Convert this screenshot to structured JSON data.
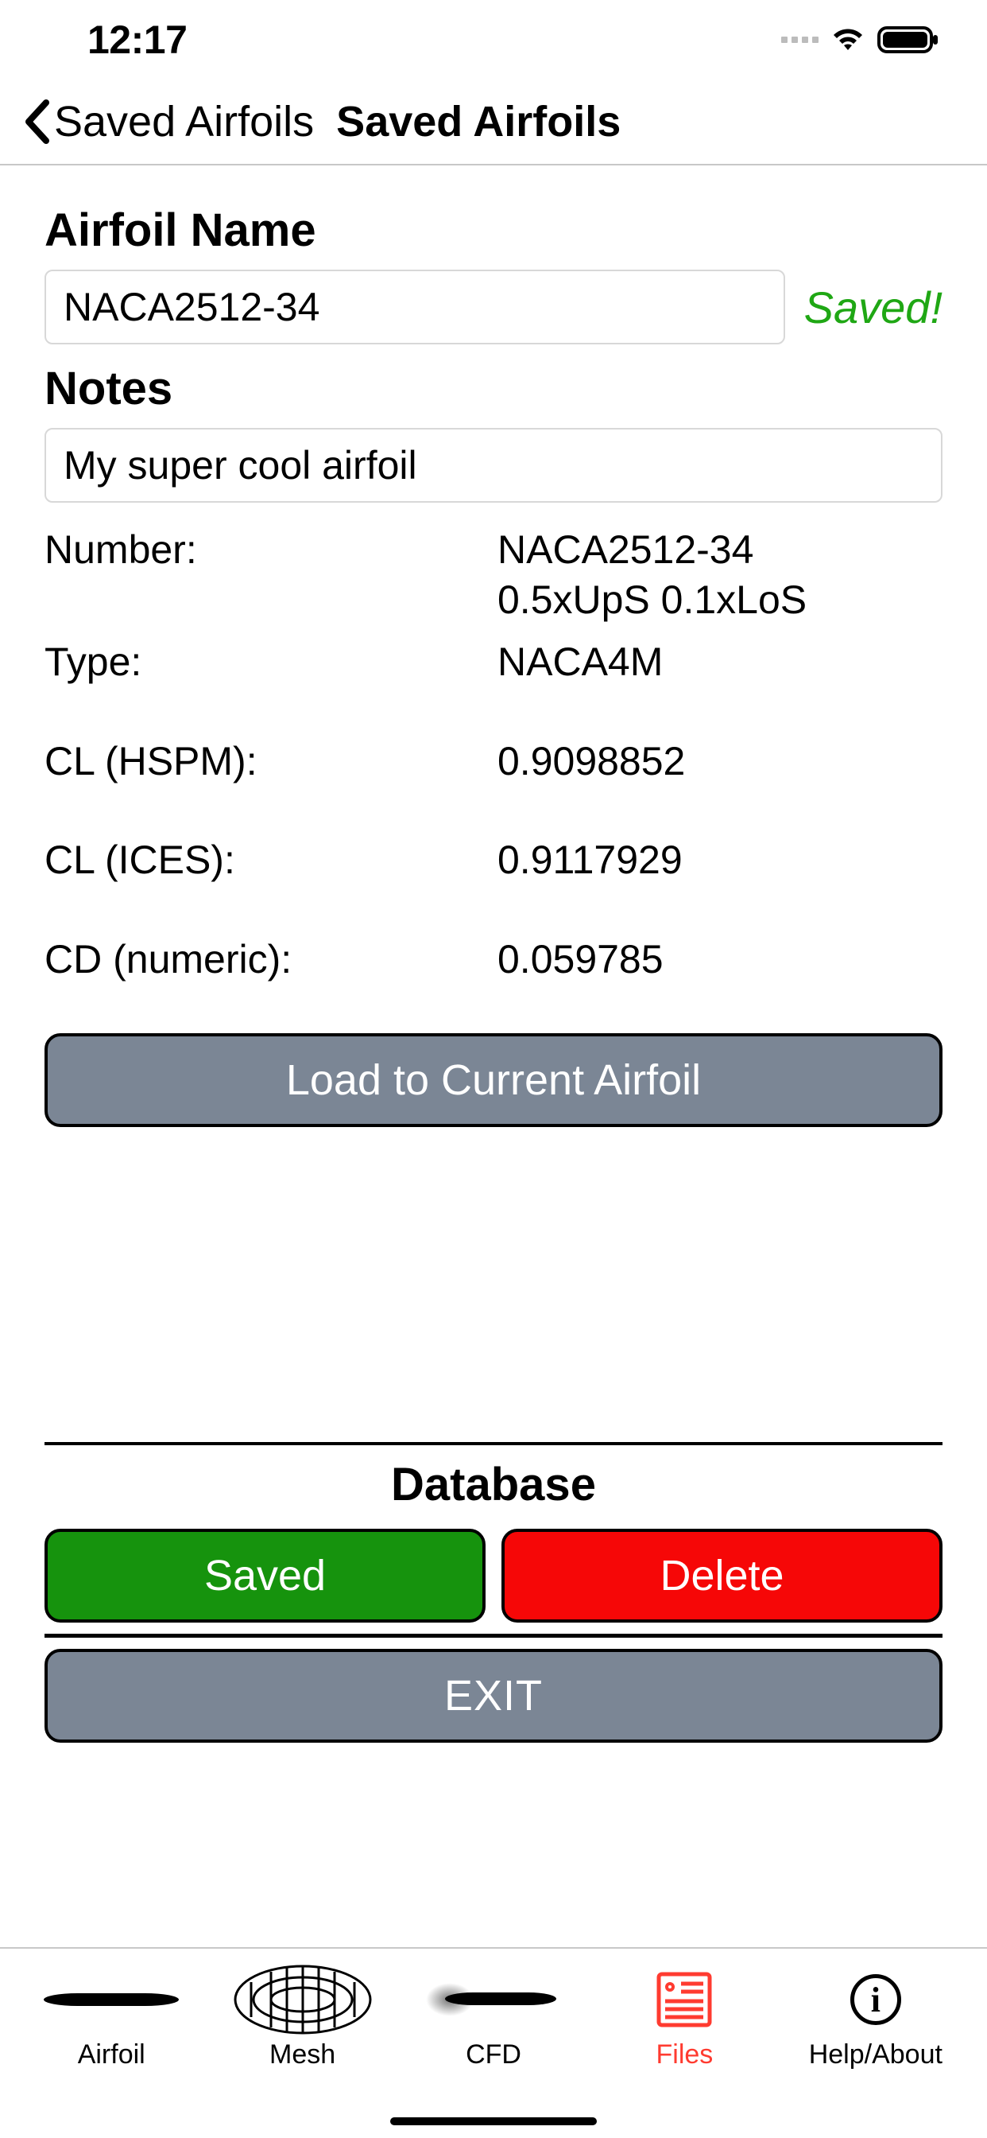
{
  "status": {
    "time": "12:17"
  },
  "nav": {
    "back_label": "Saved Airfoils",
    "title": "Saved Airfoils"
  },
  "form": {
    "name_label": "Airfoil Name",
    "name_value": "NACA2512-34",
    "saved_badge": "Saved!",
    "notes_label": "Notes",
    "notes_value": "My super cool airfoil"
  },
  "details": {
    "number_label": "Number:",
    "number_value_line1": "NACA2512-34",
    "number_value_line2": "0.5xUpS 0.1xLoS",
    "type_label": "Type:",
    "type_value": "NACA4M",
    "cl_hspm_label": "CL (HSPM):",
    "cl_hspm_value": "0.9098852",
    "cl_ices_label": "CL (ICES):",
    "cl_ices_value": "0.9117929",
    "cd_label": "CD (numeric):",
    "cd_value": "0.059785"
  },
  "buttons": {
    "load": "Load to Current Airfoil",
    "database_heading": "Database",
    "saved": "Saved",
    "delete": "Delete",
    "exit": "EXIT"
  },
  "tabs": {
    "airfoil": "Airfoil",
    "mesh": "Mesh",
    "cfd": "CFD",
    "files": "Files",
    "help": "Help/About"
  }
}
